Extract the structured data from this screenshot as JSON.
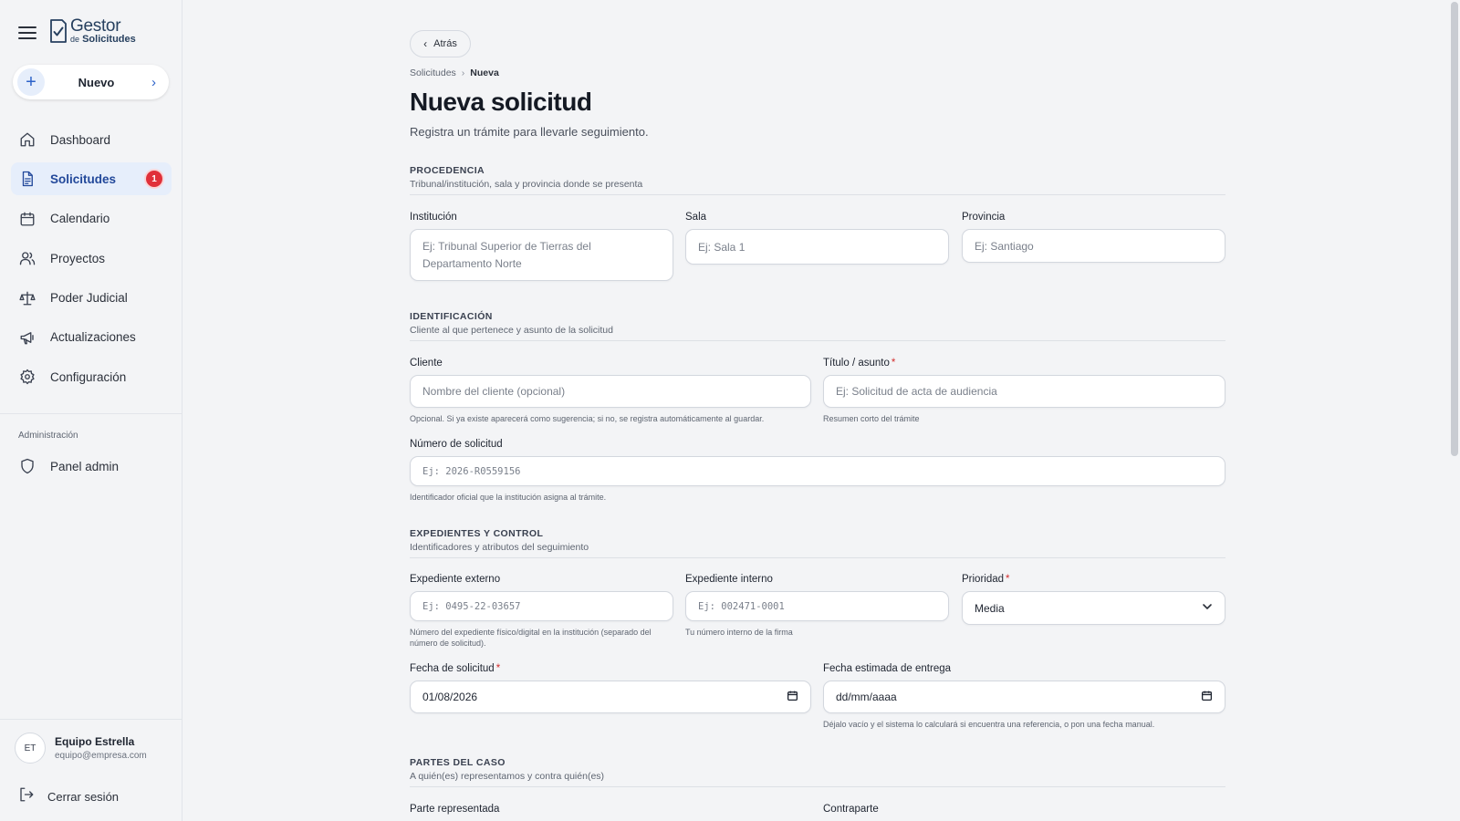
{
  "brand": {
    "title": "Gestor",
    "sub_prefix": "de",
    "sub": "Solicitudes"
  },
  "sidebar": {
    "new_button": "Nuevo",
    "items": [
      {
        "label": "Dashboard",
        "icon": "home-icon"
      },
      {
        "label": "Solicitudes",
        "icon": "document-icon",
        "badge": "1",
        "active": true
      },
      {
        "label": "Calendario",
        "icon": "calendar-icon"
      },
      {
        "label": "Proyectos",
        "icon": "users-icon"
      },
      {
        "label": "Poder Judicial",
        "icon": "scale-icon"
      },
      {
        "label": "Actualizaciones",
        "icon": "megaphone-icon"
      },
      {
        "label": "Configuración",
        "icon": "gear-icon"
      }
    ],
    "admin_title": "Administración",
    "admin_item": "Panel admin",
    "user": {
      "initials": "ET",
      "name": "Equipo Estrella",
      "email": "equipo@empresa.com"
    },
    "logout": "Cerrar sesión"
  },
  "header": {
    "back": "Atrás",
    "breadcrumb": [
      "Solicitudes",
      "Nueva"
    ],
    "title": "Nueva solicitud",
    "subtitle": "Registra un trámite para llevarle seguimiento."
  },
  "sections": {
    "procedencia": {
      "title": "PROCEDENCIA",
      "desc": "Tribunal/institución, sala y provincia donde se presenta"
    },
    "identificacion": {
      "title": "IDENTIFICACIÓN",
      "desc": "Cliente al que pertenece y asunto de la solicitud"
    },
    "expedientes": {
      "title": "EXPEDIENTES Y CONTROL",
      "desc": "Identificadores y atributos del seguimiento"
    },
    "partes": {
      "title": "PARTES DEL CASO",
      "desc": "A quién(es) representamos y contra quién(es)"
    }
  },
  "fields": {
    "institucion": {
      "label": "Institución",
      "placeholder": "Ej: Tribunal Superior de Tierras del Departamento Norte"
    },
    "sala": {
      "label": "Sala",
      "placeholder": "Ej: Sala 1"
    },
    "provincia": {
      "label": "Provincia",
      "placeholder": "Ej: Santiago"
    },
    "cliente": {
      "label": "Cliente",
      "placeholder": "Nombre del cliente (opcional)",
      "help": "Opcional. Si ya existe aparecerá como sugerencia; si no, se registra automáticamente al guardar."
    },
    "titulo": {
      "label": "Título / asunto",
      "required": "*",
      "placeholder": "Ej: Solicitud de acta de audiencia",
      "help": "Resumen corto del trámite"
    },
    "numero": {
      "label": "Número de solicitud",
      "placeholder": "Ej: 2026-R0559156",
      "help": "Identificador oficial que la institución asigna al trámite."
    },
    "exp_externo": {
      "label": "Expediente externo",
      "placeholder": "Ej: 0495-22-03657",
      "help": "Número del expediente físico/digital en la institución (separado del número de solicitud)."
    },
    "exp_interno": {
      "label": "Expediente interno",
      "placeholder": "Ej: 002471-0001",
      "help": "Tu número interno de la firma"
    },
    "prioridad": {
      "label": "Prioridad",
      "required": "*",
      "value": "Media"
    },
    "fecha_solicitud": {
      "label": "Fecha de solicitud",
      "required": "*",
      "value": "01/08/2026"
    },
    "fecha_entrega": {
      "label": "Fecha estimada de entrega",
      "value": "dd/mm/aaaa",
      "help": "Déjalo vacío y el sistema lo calculará si encuentra una referencia, o pon una fecha manual."
    },
    "parte_representada": {
      "label": "Parte representada"
    },
    "contraparte": {
      "label": "Contraparte"
    }
  },
  "colors": {
    "accent": "#2c62c9",
    "active_bg": "#e6eefb",
    "badge": "#e0303a",
    "required": "#d32f2f"
  }
}
